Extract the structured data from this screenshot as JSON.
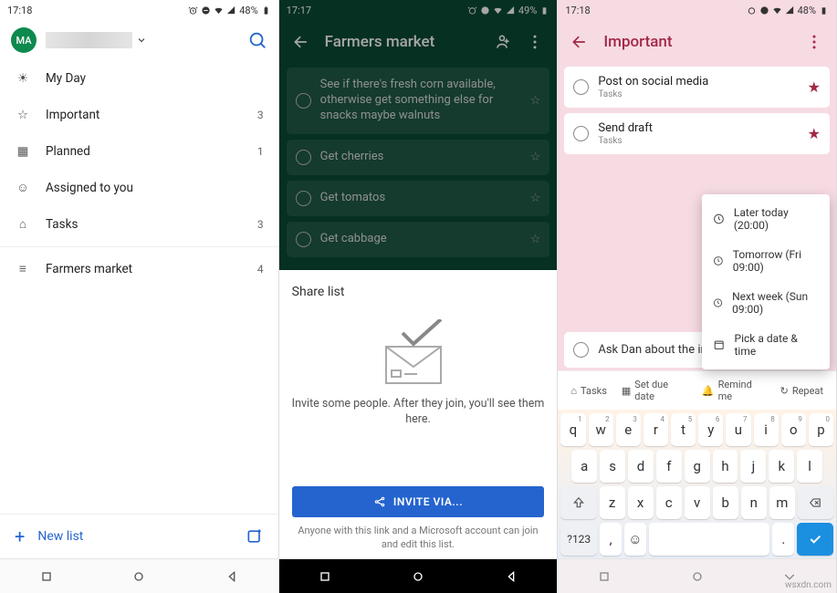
{
  "screen1": {
    "time": "17:18",
    "battery": "48%",
    "avatar_initials": "MA",
    "menu": [
      {
        "icon": "sun",
        "label": "My Day",
        "count": ""
      },
      {
        "icon": "star",
        "label": "Important",
        "count": "3"
      },
      {
        "icon": "calendar",
        "label": "Planned",
        "count": "1"
      },
      {
        "icon": "person",
        "label": "Assigned to you",
        "count": ""
      },
      {
        "icon": "home",
        "label": "Tasks",
        "count": "3"
      }
    ],
    "lists": [
      {
        "icon": "list",
        "label": "Farmers market",
        "count": "4"
      }
    ],
    "new_list": "New list"
  },
  "screen2": {
    "time": "17:17",
    "battery": "49%",
    "title": "Farmers market",
    "tasks": [
      "See if there's fresh corn available, otherwise get something else for snacks maybe walnuts",
      "Get cherries",
      "Get tomatos",
      "Get cabbage"
    ],
    "sheet_title": "Share list",
    "invite_msg": "Invite some people. After they join, you'll see them here.",
    "invite_btn": "INVITE VIA...",
    "invite_sub": "Anyone with this link and a Microsoft account can join and edit this list."
  },
  "screen3": {
    "time": "17:18",
    "battery": "48%",
    "title": "Important",
    "tasks": [
      {
        "title": "Post on social media",
        "sub": "Tasks"
      },
      {
        "title": "Send draft",
        "sub": "Tasks"
      }
    ],
    "input_text": "Ask Dan about the inte",
    "popup": [
      "Later today (20:00)",
      "Tomorrow (Fri 09:00)",
      "Next week (Sun 09:00)",
      "Pick a date & time"
    ],
    "toolbar": [
      "Tasks",
      "Set due date",
      "Remind me",
      "Repeat"
    ],
    "kbd_row1": [
      [
        "q",
        "1"
      ],
      [
        "w",
        "2"
      ],
      [
        "e",
        "3"
      ],
      [
        "r",
        "4"
      ],
      [
        "t",
        "5"
      ],
      [
        "y",
        "6"
      ],
      [
        "u",
        "7"
      ],
      [
        "i",
        "8"
      ],
      [
        "o",
        "9"
      ],
      [
        "p",
        "0"
      ]
    ],
    "kbd_row2": [
      "a",
      "s",
      "d",
      "f",
      "g",
      "h",
      "j",
      "k",
      "l"
    ],
    "kbd_row3": [
      "z",
      "x",
      "c",
      "v",
      "b",
      "n",
      "m"
    ],
    "kbd_num": "?123"
  },
  "watermark": "wsxdn.com"
}
